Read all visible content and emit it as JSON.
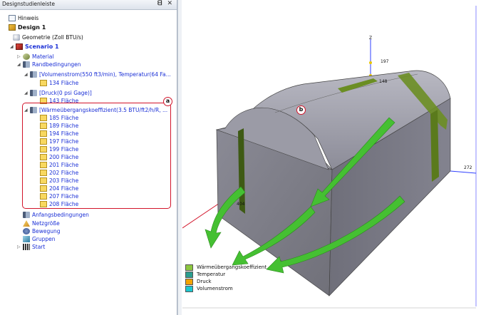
{
  "panel": {
    "title": "Designstudienleiste",
    "buttons": "ᗺ ✕"
  },
  "tree": {
    "hint": "Hinweis",
    "design": "Design 1",
    "geometry": "Geometrie (Zoll BTU/s)",
    "scenario": "Scenario 1",
    "material": "Material",
    "boundary": "Randbedingungen",
    "bc1": "[Volumenstrom(550 ft3/min), Temperatur(64 Fa...",
    "bc1_face": "134 Fläche",
    "bc2": "[Druck(0 psi Gage)]",
    "bc2_face": "143 Fläche",
    "bc3": "[Wärmeübergangskoeffizient(3.5 BTU/ft2/h/R, ...",
    "bc3_faces": [
      "185 Fläche",
      "189 Fläche",
      "194 Fläche",
      "197 Fläche",
      "199 Fläche",
      "200 Fläche",
      "201 Fläche",
      "202 Fläche",
      "203 Fläche",
      "204 Fläche",
      "207 Fläche",
      "208 Fläche"
    ],
    "initial": "Anfangsbedingungen",
    "mesh": "Netzgröße",
    "motion": "Bewegung",
    "groups": "Gruppen",
    "start": "Start"
  },
  "callouts": {
    "a": "a",
    "b": "b"
  },
  "viewport": {
    "axis_z": "Z",
    "axis_y": "272",
    "label_197": "197",
    "label_148": "148",
    "label_204": "404"
  },
  "legend": [
    {
      "label": "Wärmeübergangskoeffizient",
      "color": "#8cc63f"
    },
    {
      "label": "Temperatur",
      "color": "#2a9d8f"
    },
    {
      "label": "Druck",
      "color": "#f4a300"
    },
    {
      "label": "Volumenstrom",
      "color": "#1cc7d0"
    }
  ]
}
